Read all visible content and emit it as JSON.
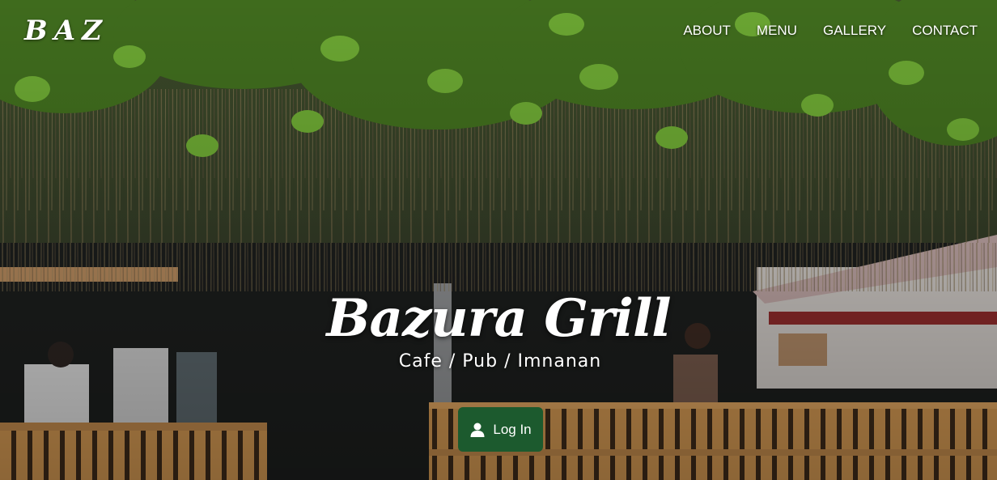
{
  "brand": {
    "logo_text": "BAZ"
  },
  "nav": {
    "items": [
      {
        "label": "ABOUT"
      },
      {
        "label": "MENU"
      },
      {
        "label": "GALLERY"
      },
      {
        "label": "CONTACT"
      }
    ]
  },
  "hero": {
    "title": "Bazura Grill",
    "subtitle": "Cafe / Pub / Imnanan",
    "login_label": "Log In",
    "login_icon": "user-icon"
  },
  "colors": {
    "button_bg": "#1c5a2e",
    "text": "#ffffff"
  }
}
